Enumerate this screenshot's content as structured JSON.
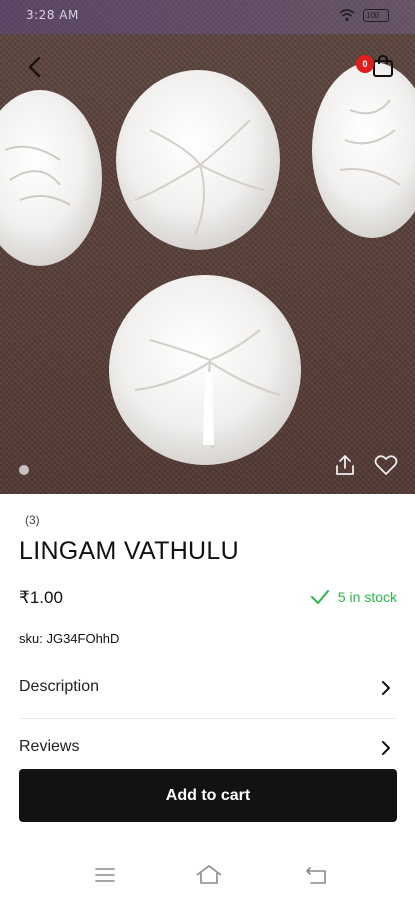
{
  "status_bar": {
    "time": "3:28 AM",
    "battery": "100"
  },
  "header": {
    "cart_count": "0"
  },
  "gallery": {
    "image_count": 1,
    "active_index": 0
  },
  "product": {
    "rating_count": "(3)",
    "name": "LINGAM VATHULU",
    "price": "₹1.00",
    "stock_text": "5 in stock",
    "sku": "sku: JG34FOhhD"
  },
  "sections": [
    {
      "label": "Description"
    },
    {
      "label": "Reviews"
    }
  ],
  "actions": {
    "add_to_cart_label": "Add to cart"
  },
  "colors": {
    "accent": "#121212",
    "in_stock": "#29b84b",
    "badge": "#e11d1d"
  },
  "icons": [
    "back-arrow-icon",
    "cart-icon",
    "share-icon",
    "heart-icon",
    "chevron-right-icon",
    "check-icon",
    "menu-icon",
    "home-icon",
    "back-nav-icon"
  ]
}
